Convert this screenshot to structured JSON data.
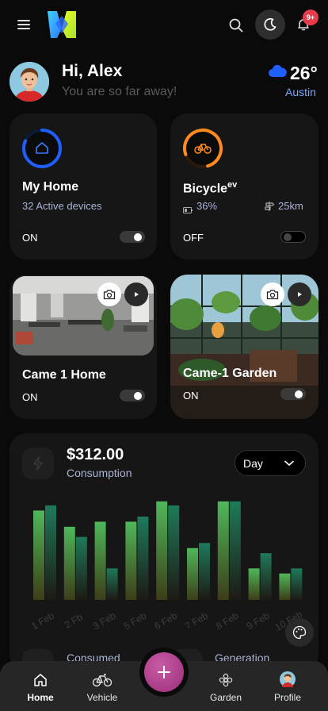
{
  "header": {
    "greeting": "Hi, Alex",
    "subtitle": "You are so far away!",
    "temperature": "26°",
    "city": "Austin",
    "notification_count": "9+"
  },
  "cards": {
    "home": {
      "title": "My Home",
      "subtitle": "32 Active devices",
      "state": "ON",
      "toggle_on": true
    },
    "bicycle": {
      "title": "Bicycle",
      "title_sup": "ev",
      "battery": "36%",
      "range": "25km",
      "state": "OFF",
      "toggle_on": false
    },
    "cam_home": {
      "title": "Came 1 Home",
      "state": "ON",
      "toggle_on": true
    },
    "cam_garden": {
      "title": "Came-1 Garden",
      "state": "ON",
      "toggle_on": true
    }
  },
  "consumption": {
    "amount": "$312.00",
    "label": "Consumption",
    "period": "Day",
    "legend_consumed": "Consumed",
    "legend_generation": "Generation"
  },
  "chart_data": {
    "type": "bar",
    "categories": [
      "1 Feb",
      "2 Fb",
      "3 Feb",
      "5 Feb",
      "6 Feb",
      "7 Feb",
      "8 Feb",
      "9 Feb",
      "10 Feb"
    ],
    "series": [
      {
        "name": "Consumed",
        "values": [
          0.88,
          0.72,
          0.77,
          0.77,
          0.97,
          0.51,
          0.97,
          0.31,
          0.26
        ]
      },
      {
        "name": "Generation",
        "values": [
          0.93,
          0.62,
          0.31,
          0.82,
          0.93,
          0.56,
          0.97,
          0.46,
          0.31
        ]
      }
    ],
    "grid": false,
    "colors": {
      "consumed_top": "#4fb85a",
      "consumed_bottom": "#3d3d18",
      "generation_top": "#1e7a5a",
      "generation_bottom": "#1d1a14"
    }
  },
  "nav": {
    "items": [
      {
        "label": "Home",
        "icon": "home-icon"
      },
      {
        "label": "Vehicle",
        "icon": "bicycle-icon"
      },
      {
        "label": "Garden",
        "icon": "flower-icon"
      },
      {
        "label": "Profile",
        "icon": "avatar"
      }
    ],
    "fab_icon": "plus-icon"
  },
  "colors": {
    "accent_blue": "#1f5fff",
    "accent_orange": "#ff8a1f",
    "fab": "#b0418f",
    "badge": "#e83b4b"
  }
}
